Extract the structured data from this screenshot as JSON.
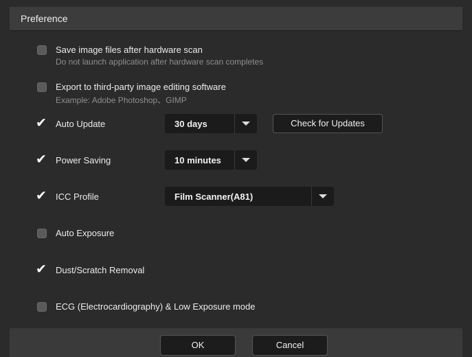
{
  "window": {
    "title": "Preference"
  },
  "options": {
    "save_files": {
      "label": "Save image files after hardware scan",
      "sub": "Do not launch application after hardware scan completes",
      "checked": false
    },
    "export_third_party": {
      "label": "Export to third-party image editing software",
      "sub": "Example: Adobe Photoshop、GIMP",
      "checked": false
    },
    "auto_update": {
      "label": "Auto Update",
      "checked": true,
      "value": "30 days"
    },
    "power_saving": {
      "label": "Power Saving",
      "checked": true,
      "value": "10 minutes"
    },
    "icc_profile": {
      "label": "ICC Profile",
      "checked": true,
      "value": "Film Scanner(A81)"
    },
    "auto_exposure": {
      "label": "Auto Exposure",
      "checked": false
    },
    "dust_removal": {
      "label": "Dust/Scratch Removal",
      "checked": true
    },
    "ecg_mode": {
      "label": "ECG (Electrocardiography) & Low Exposure mode",
      "checked": false
    }
  },
  "buttons": {
    "check_updates": "Check for Updates",
    "ok": "OK",
    "cancel": "Cancel"
  },
  "icons": {
    "checkmark": "✔"
  }
}
